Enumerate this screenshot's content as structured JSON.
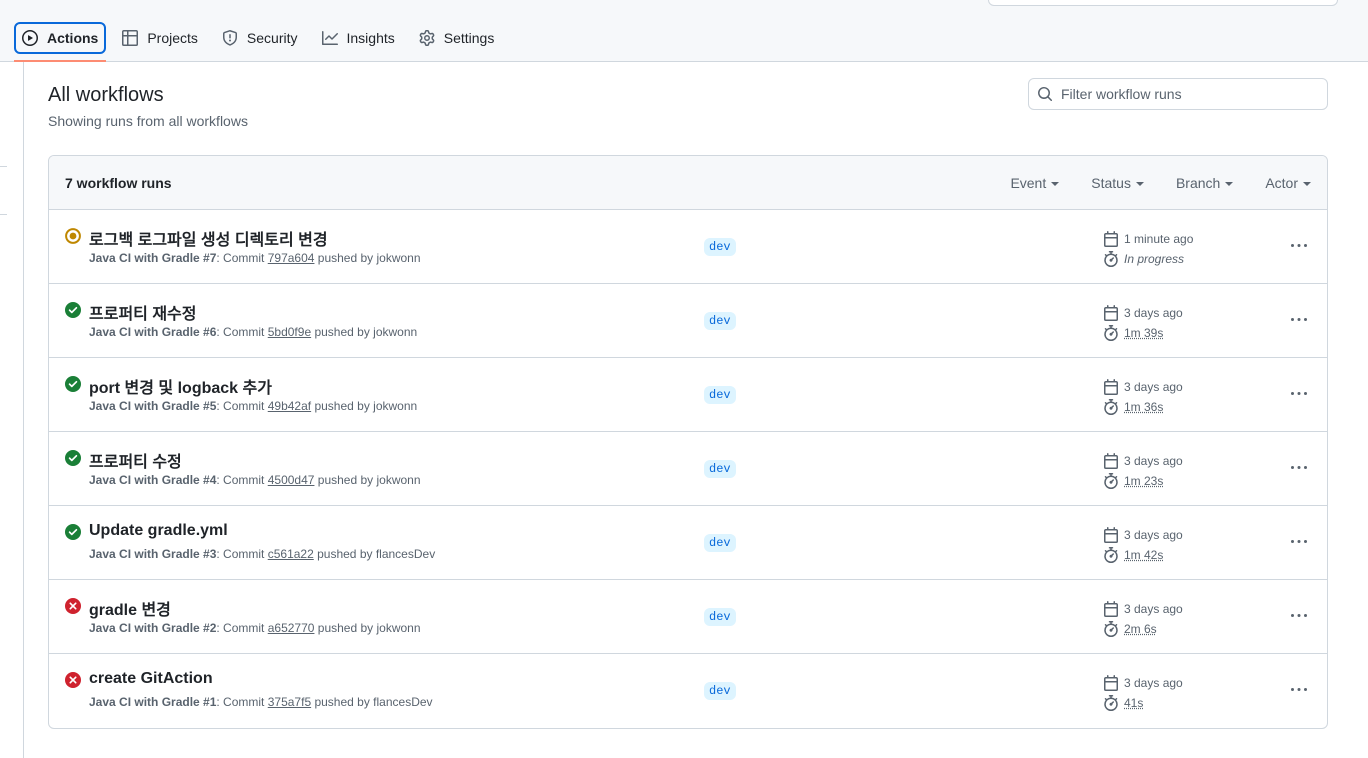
{
  "nav": {
    "tabs": [
      {
        "label": "Actions",
        "icon": "play-icon",
        "active": true
      },
      {
        "label": "Projects",
        "icon": "table-icon",
        "active": false
      },
      {
        "label": "Security",
        "icon": "shield-icon",
        "active": false
      },
      {
        "label": "Insights",
        "icon": "graph-icon",
        "active": false
      },
      {
        "label": "Settings",
        "icon": "gear-icon",
        "active": false
      }
    ]
  },
  "header": {
    "title": "All workflows",
    "subtitle": "Showing runs from all workflows",
    "filter_placeholder": "Filter workflow runs"
  },
  "runs": {
    "count_label": "7 workflow runs",
    "filters": [
      "Event",
      "Status",
      "Branch",
      "Actor"
    ],
    "items": [
      {
        "status": "in_progress",
        "title": "로그백 로그파일 생성 디렉토리 변경",
        "workflow": "Java CI with Gradle #7",
        "commit_prefix": ": Commit ",
        "sha": "797a604",
        "pushed_by": " pushed by jokwonn",
        "branch": "dev",
        "started": "1 minute ago",
        "duration": "In progress"
      },
      {
        "status": "success",
        "title": "프로퍼티 재수정",
        "workflow": "Java CI with Gradle #6",
        "commit_prefix": ": Commit ",
        "sha": "5bd0f9e",
        "pushed_by": " pushed by jokwonn",
        "branch": "dev",
        "started": "3 days ago",
        "duration": "1m 39s"
      },
      {
        "status": "success",
        "title": "port 변경 및 logback 추가",
        "workflow": "Java CI with Gradle #5",
        "commit_prefix": ": Commit ",
        "sha": "49b42af",
        "pushed_by": " pushed by jokwonn",
        "branch": "dev",
        "started": "3 days ago",
        "duration": "1m 36s"
      },
      {
        "status": "success",
        "title": "프로퍼티 수정",
        "workflow": "Java CI with Gradle #4",
        "commit_prefix": ": Commit ",
        "sha": "4500d47",
        "pushed_by": " pushed by jokwonn",
        "branch": "dev",
        "started": "3 days ago",
        "duration": "1m 23s"
      },
      {
        "status": "success",
        "title": "Update gradle.yml",
        "workflow": "Java CI with Gradle #3",
        "commit_prefix": ": Commit ",
        "sha": "c561a22",
        "pushed_by": " pushed by flancesDev",
        "branch": "dev",
        "started": "3 days ago",
        "duration": "1m 42s"
      },
      {
        "status": "failure",
        "title": "gradle 변경",
        "workflow": "Java CI with Gradle #2",
        "commit_prefix": ": Commit ",
        "sha": "a652770",
        "pushed_by": " pushed by jokwonn",
        "branch": "dev",
        "started": "3 days ago",
        "duration": "2m 6s"
      },
      {
        "status": "failure",
        "title": "create GitAction",
        "workflow": "Java CI with Gradle #1",
        "commit_prefix": ": Commit ",
        "sha": "375a7f5",
        "pushed_by": " pushed by flancesDev",
        "branch": "dev",
        "started": "3 days ago",
        "duration": "41s"
      }
    ]
  },
  "colors": {
    "success": "#1a7f37",
    "failure": "#cf222e",
    "in_progress": "#bf8700",
    "accent": "#0969da",
    "tab_underline": "#fd8c73"
  }
}
